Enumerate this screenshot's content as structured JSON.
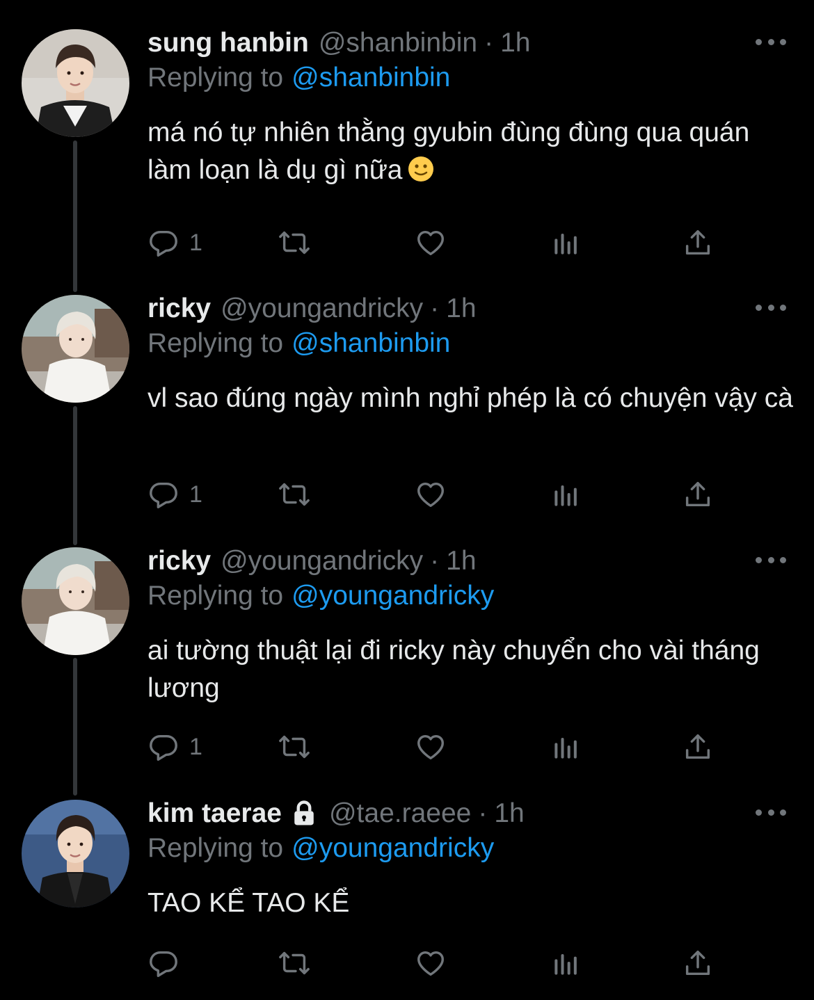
{
  "tweets": [
    {
      "name": "sung hanbin",
      "handle": "@shanbinbin",
      "separator": "·",
      "time": "1h",
      "replying_prefix": "Replying to",
      "replying_to": "@shanbinbin",
      "text": "má nó tự nhiên thằng gyubin đùng đùng qua quán làm loạn là dụ gì nữa",
      "reply_count": "1",
      "locked": false
    },
    {
      "name": "ricky",
      "handle": "@youngandricky",
      "separator": "·",
      "time": "1h",
      "replying_prefix": "Replying to",
      "replying_to": "@shanbinbin",
      "text": "vl sao đúng ngày mình nghỉ phép là có chuyện vậy cà",
      "reply_count": "1",
      "locked": false
    },
    {
      "name": "ricky",
      "handle": "@youngandricky",
      "separator": "·",
      "time": "1h",
      "replying_prefix": "Replying to",
      "replying_to": "@youngandricky",
      "text": "ai tường thuật lại đi ricky này chuyển cho vài tháng lương",
      "reply_count": "1",
      "locked": false
    },
    {
      "name": "kim taerae",
      "handle": "@tae.raeee",
      "separator": "·",
      "time": "1h",
      "replying_prefix": "Replying to",
      "replying_to": "@youngandricky",
      "text": "TAO KỂ TAO KỂ",
      "reply_count": "",
      "locked": true
    }
  ],
  "icons": {
    "reply": "reply-icon",
    "retweet": "retweet-icon",
    "like": "heart-icon",
    "views": "views-icon",
    "share": "share-icon",
    "more": "more-icon",
    "lock": "lock-icon",
    "emoji": "slightly-smiling-face-emoji"
  },
  "colors": {
    "background": "#000000",
    "text": "#e7e9ea",
    "secondary": "#71767b",
    "accent": "#1d9bf0",
    "thread_line": "#333639"
  }
}
